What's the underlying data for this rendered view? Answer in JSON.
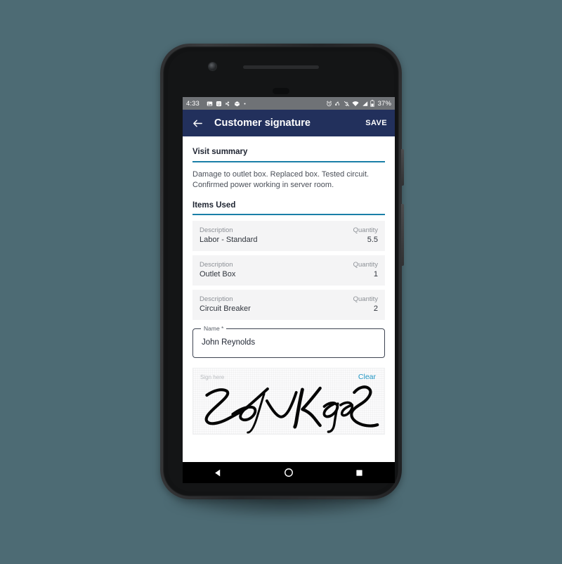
{
  "device": {
    "front_camera_icon": "front-camera",
    "earpiece_icon": "earpiece-speaker",
    "proximity_sensor_icon": "proximity-sensor"
  },
  "status_bar": {
    "clock": "4:33",
    "battery_percent": "37%",
    "left_icons": [
      "image-icon",
      "emoji-icon",
      "bluetooth-share-icon",
      "package-icon",
      "dot-icon"
    ],
    "right_icons": [
      "alarm-icon",
      "sync-icon",
      "notifications-off-icon",
      "wifi-icon",
      "signal-icon",
      "battery-icon"
    ],
    "background": "#6f7276"
  },
  "app_bar": {
    "back_icon": "back-arrow-icon",
    "title": "Customer signature",
    "save_label": "SAVE",
    "background": "#22305c"
  },
  "content": {
    "visit_summary": {
      "heading": "Visit summary",
      "text": "Damage to outlet box. Replaced box. Tested circuit. Confirmed power working in server room."
    },
    "items_used": {
      "heading": "Items Used",
      "columns": {
        "description_label": "Description",
        "quantity_label": "Quantity"
      },
      "rows": [
        {
          "description": "Labor - Standard",
          "quantity": "5.5"
        },
        {
          "description": "Outlet Box",
          "quantity": "1"
        },
        {
          "description": "Circuit Breaker",
          "quantity": "2"
        }
      ]
    },
    "name_field": {
      "label": "Name *",
      "value": "John Reynolds",
      "placeholder": "Name"
    },
    "signature_pad": {
      "hint": "Sign here",
      "clear_label": "Clear",
      "signature_present": true
    },
    "accent_color": "#1a7fa8",
    "link_color": "#2196c4"
  },
  "nav_bar": {
    "back_key": "nav-back-icon",
    "home_key": "nav-home-icon",
    "recents_key": "nav-recents-icon"
  },
  "page_background": "#4d6b74"
}
